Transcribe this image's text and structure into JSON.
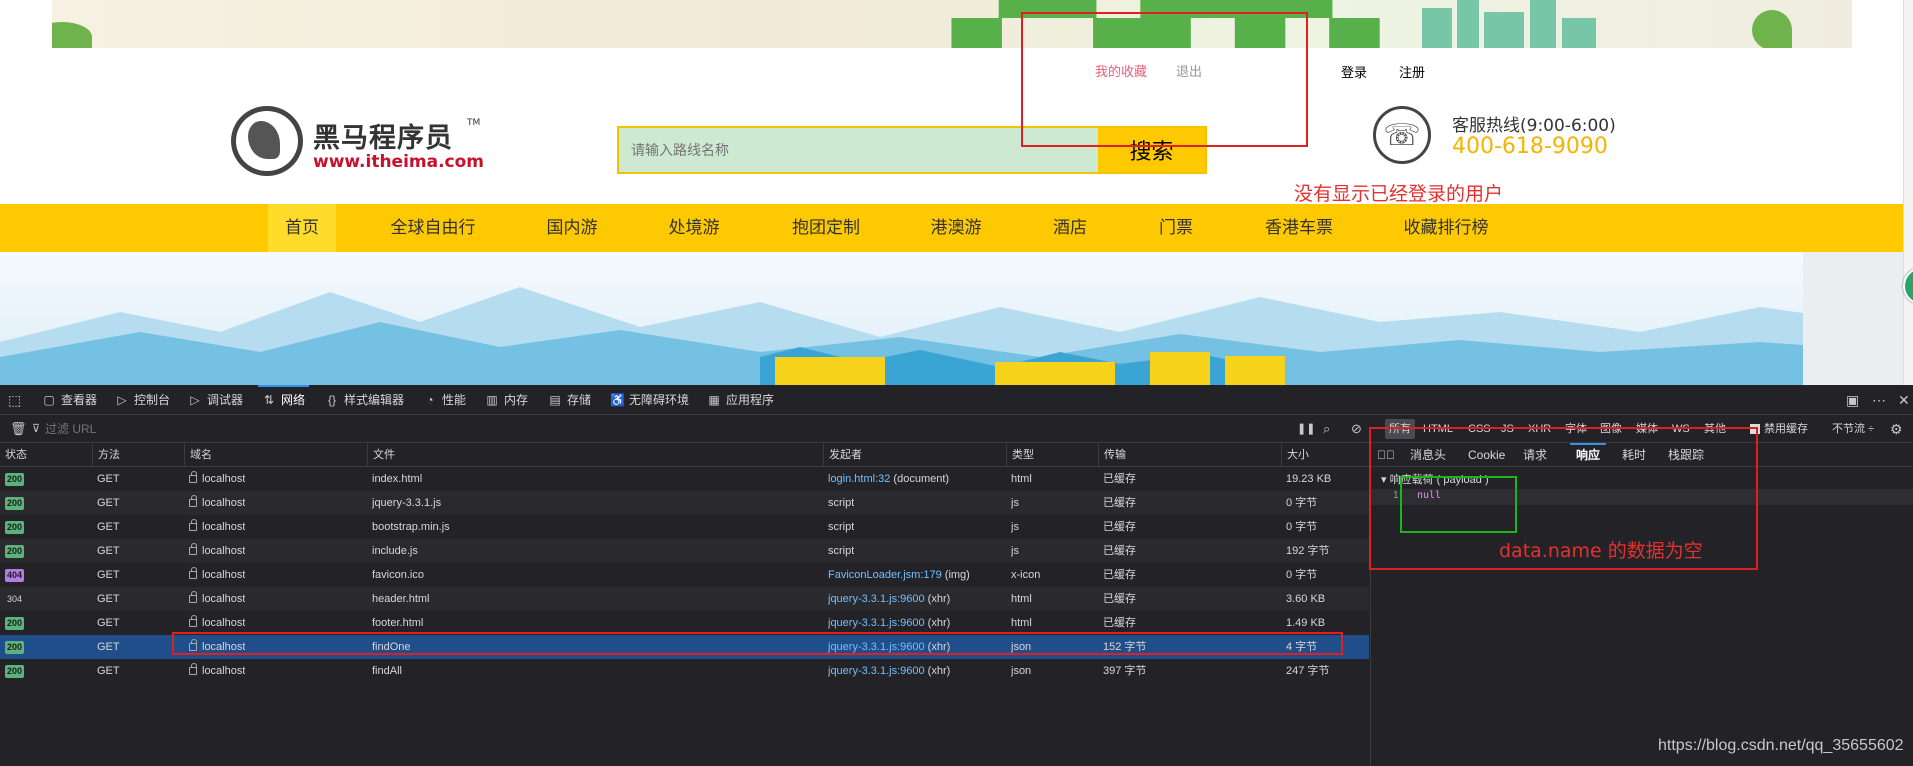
{
  "web": {
    "user_links": {
      "favorites": "我的收藏",
      "logout": "退出"
    },
    "auth_links": {
      "login": "登录",
      "register": "注册"
    },
    "logo": {
      "name": "黑马程序员",
      "tm": "TM",
      "url": "www.itheima.com"
    },
    "search": {
      "placeholder": "请输入路线名称",
      "button": "搜索"
    },
    "hotline": {
      "label": "客服热线(9:00-6:00)",
      "number": "400-618-9090"
    },
    "annotation_top": "没有显示已经登录的用户",
    "nav": [
      "首页",
      "全球自由行",
      "国内游",
      "处境游",
      "抱团定制",
      "港澳游",
      "酒店",
      "门票",
      "香港车票",
      "收藏排行榜"
    ],
    "colors": {
      "nav_bg": "#ffc900",
      "accent": "#f5b400",
      "favorites": "#e8607a",
      "annotation": "#e53030"
    }
  },
  "devtools": {
    "tabs": [
      {
        "label": "查看器",
        "icon": "inspector-icon"
      },
      {
        "label": "控制台",
        "icon": "console-icon"
      },
      {
        "label": "调试器",
        "icon": "debugger-icon"
      },
      {
        "label": "网络",
        "icon": "network-icon"
      },
      {
        "label": "样式编辑器",
        "icon": "style-editor-icon"
      },
      {
        "label": "性能",
        "icon": "performance-icon"
      },
      {
        "label": "内存",
        "icon": "memory-icon"
      },
      {
        "label": "存储",
        "icon": "storage-icon"
      },
      {
        "label": "无障碍环境",
        "icon": "accessibility-icon"
      },
      {
        "label": "应用程序",
        "icon": "application-icon"
      }
    ],
    "active_tab": "网络",
    "filter": {
      "placeholder": "过滤 URL",
      "types": [
        "所有",
        "HTML",
        "CSS",
        "JS",
        "XHR",
        "字体",
        "图像",
        "媒体",
        "WS",
        "其他"
      ],
      "disable_cache": "禁用缓存",
      "throttle": "不节流 ÷"
    },
    "columns": [
      "状态",
      "方法",
      "域名",
      "文件",
      "发起者",
      "类型",
      "传输",
      "大小"
    ],
    "rows": [
      {
        "status": "200",
        "method": "GET",
        "domain": "localhost",
        "file": "index.html",
        "initiator_link": "login.html:32",
        "initiator_extra": " (document)",
        "type": "html",
        "transfer": "已缓存",
        "size": "19.23 KB"
      },
      {
        "status": "200",
        "method": "GET",
        "domain": "localhost",
        "file": "jquery-3.3.1.js",
        "initiator_link": "",
        "initiator_extra": "script",
        "type": "js",
        "transfer": "已缓存",
        "size": "0 字节"
      },
      {
        "status": "200",
        "method": "GET",
        "domain": "localhost",
        "file": "bootstrap.min.js",
        "initiator_link": "",
        "initiator_extra": "script",
        "type": "js",
        "transfer": "已缓存",
        "size": "0 字节"
      },
      {
        "status": "200",
        "method": "GET",
        "domain": "localhost",
        "file": "include.js",
        "initiator_link": "",
        "initiator_extra": "script",
        "type": "js",
        "transfer": "已缓存",
        "size": "192 字节"
      },
      {
        "status": "404",
        "method": "GET",
        "domain": "localhost",
        "file": "favicon.ico",
        "initiator_link": "FaviconLoader.jsm:179",
        "initiator_extra": " (img)",
        "type": "x-icon",
        "transfer": "已缓存",
        "size": "0 字节"
      },
      {
        "status": "304",
        "method": "GET",
        "domain": "localhost",
        "file": "header.html",
        "initiator_link": "jquery-3.3.1.js:9600",
        "initiator_extra": " (xhr)",
        "type": "html",
        "transfer": "已缓存",
        "size": "3.60 KB"
      },
      {
        "status": "200",
        "method": "GET",
        "domain": "localhost",
        "file": "footer.html",
        "initiator_link": "jquery-3.3.1.js:9600",
        "initiator_extra": " (xhr)",
        "type": "html",
        "transfer": "已缓存",
        "size": "1.49 KB"
      },
      {
        "status": "200",
        "method": "GET",
        "domain": "localhost",
        "file": "findOne",
        "initiator_link": "jquery-3.3.1.js:9600",
        "initiator_extra": " (xhr)",
        "type": "json",
        "transfer": "152 字节",
        "size": "4 字节"
      },
      {
        "status": "200",
        "method": "GET",
        "domain": "localhost",
        "file": "findAll",
        "initiator_link": "jquery-3.3.1.js:9600",
        "initiator_extra": " (xhr)",
        "type": "json",
        "transfer": "397 字节",
        "size": "247 字节"
      }
    ],
    "selected_row": 7,
    "panel": {
      "tabs": [
        "消息头",
        "Cookie",
        "请求",
        "响应",
        "耗时",
        "栈跟踪"
      ],
      "active_tab": "响应",
      "section": "响应载荷 ( payload )",
      "line_no": "1",
      "value": "null",
      "annotation": "data.name 的数据为空"
    }
  },
  "watermark": "https://blog.csdn.net/qq_35655602"
}
